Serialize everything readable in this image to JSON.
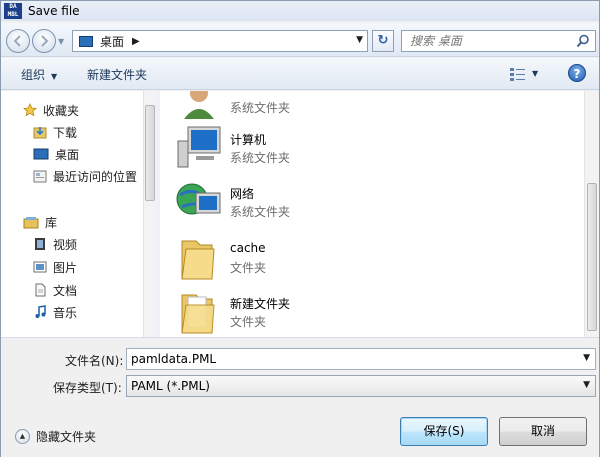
{
  "window": {
    "title": "Save file",
    "app_icon_text_top": "DA",
    "app_icon_text_bottom": "MBL"
  },
  "address_bar": {
    "path": "桌面",
    "refresh_symbol": "↻"
  },
  "search": {
    "placeholder": "搜索 桌面"
  },
  "toolbar": {
    "organize_label": "组织",
    "new_folder_label": "新建文件夹",
    "help_label": "?"
  },
  "nav_pane": {
    "items": [
      {
        "label": "收藏夹",
        "icon": "star-icon"
      },
      {
        "label": "下载",
        "icon": "downloads-folder-icon"
      },
      {
        "label": "桌面",
        "icon": "desktop-icon"
      },
      {
        "label": "最近访问的位置",
        "icon": "recent-places-icon"
      },
      {
        "label": "库",
        "icon": "library-icon"
      },
      {
        "label": "视频",
        "icon": "video-library-icon"
      },
      {
        "label": "图片",
        "icon": "pictures-library-icon"
      },
      {
        "label": "文档",
        "icon": "documents-library-icon"
      },
      {
        "label": "音乐",
        "icon": "music-library-icon"
      }
    ]
  },
  "files": [
    {
      "name": "",
      "type": "系统文件夹",
      "icon": "user-folder-icon"
    },
    {
      "name": "计算机",
      "type": "系统文件夹",
      "icon": "computer-icon"
    },
    {
      "name": "网络",
      "type": "系统文件夹",
      "icon": "network-icon"
    },
    {
      "name": "cache",
      "type": "文件夹",
      "icon": "folder-icon"
    },
    {
      "name": "新建文件夹",
      "type": "文件夹",
      "icon": "folder-icon"
    }
  ],
  "form": {
    "filename_label": "文件名(N):",
    "filename_value": "pamldata.PML",
    "filetype_label": "保存类型(T):",
    "filetype_value": "PAML (*.PML)"
  },
  "footer": {
    "hide_folders_label": "隐藏文件夹",
    "save_label": "保存(S)",
    "cancel_label": "取消"
  },
  "colors": {
    "accent": "#1e395b",
    "title_bg": "#dbe5f2",
    "selected_button": "#bee6fd"
  }
}
